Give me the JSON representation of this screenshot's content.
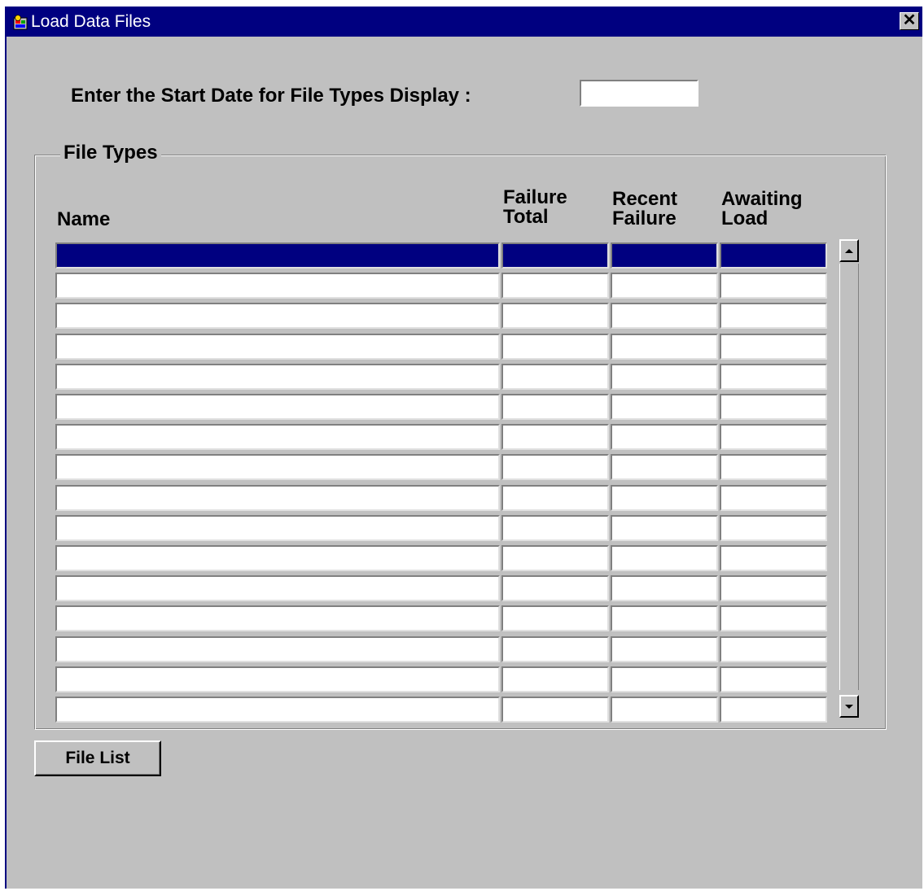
{
  "window": {
    "title": "Load Data Files",
    "close_label": "✕"
  },
  "form": {
    "start_date_label": "Enter the Start Date for File Types Display  :",
    "start_date_value": ""
  },
  "file_types": {
    "group_label": "File Types",
    "columns": {
      "name": "Name",
      "failure_total_1": "Failure",
      "failure_total_2": "Total",
      "recent_failure_1": "Recent",
      "recent_failure_2": "Failure",
      "awaiting_load_1": "Awaiting",
      "awaiting_load_2": "Load"
    },
    "rows": [
      {
        "name": "",
        "failure_total": "",
        "recent_failure": "",
        "awaiting_load": ""
      },
      {
        "name": "",
        "failure_total": "",
        "recent_failure": "",
        "awaiting_load": ""
      },
      {
        "name": "",
        "failure_total": "",
        "recent_failure": "",
        "awaiting_load": ""
      },
      {
        "name": "",
        "failure_total": "",
        "recent_failure": "",
        "awaiting_load": ""
      },
      {
        "name": "",
        "failure_total": "",
        "recent_failure": "",
        "awaiting_load": ""
      },
      {
        "name": "",
        "failure_total": "",
        "recent_failure": "",
        "awaiting_load": ""
      },
      {
        "name": "",
        "failure_total": "",
        "recent_failure": "",
        "awaiting_load": ""
      },
      {
        "name": "",
        "failure_total": "",
        "recent_failure": "",
        "awaiting_load": ""
      },
      {
        "name": "",
        "failure_total": "",
        "recent_failure": "",
        "awaiting_load": ""
      },
      {
        "name": "",
        "failure_total": "",
        "recent_failure": "",
        "awaiting_load": ""
      },
      {
        "name": "",
        "failure_total": "",
        "recent_failure": "",
        "awaiting_load": ""
      },
      {
        "name": "",
        "failure_total": "",
        "recent_failure": "",
        "awaiting_load": ""
      },
      {
        "name": "",
        "failure_total": "",
        "recent_failure": "",
        "awaiting_load": ""
      },
      {
        "name": "",
        "failure_total": "",
        "recent_failure": "",
        "awaiting_load": ""
      },
      {
        "name": "",
        "failure_total": "",
        "recent_failure": "",
        "awaiting_load": ""
      },
      {
        "name": "",
        "failure_total": "",
        "recent_failure": "",
        "awaiting_load": ""
      }
    ],
    "selected_row": 0
  },
  "buttons": {
    "file_list": "File List"
  },
  "colors": {
    "titlebar": "#000080",
    "selection": "#000080",
    "face": "#c0c0c0"
  }
}
